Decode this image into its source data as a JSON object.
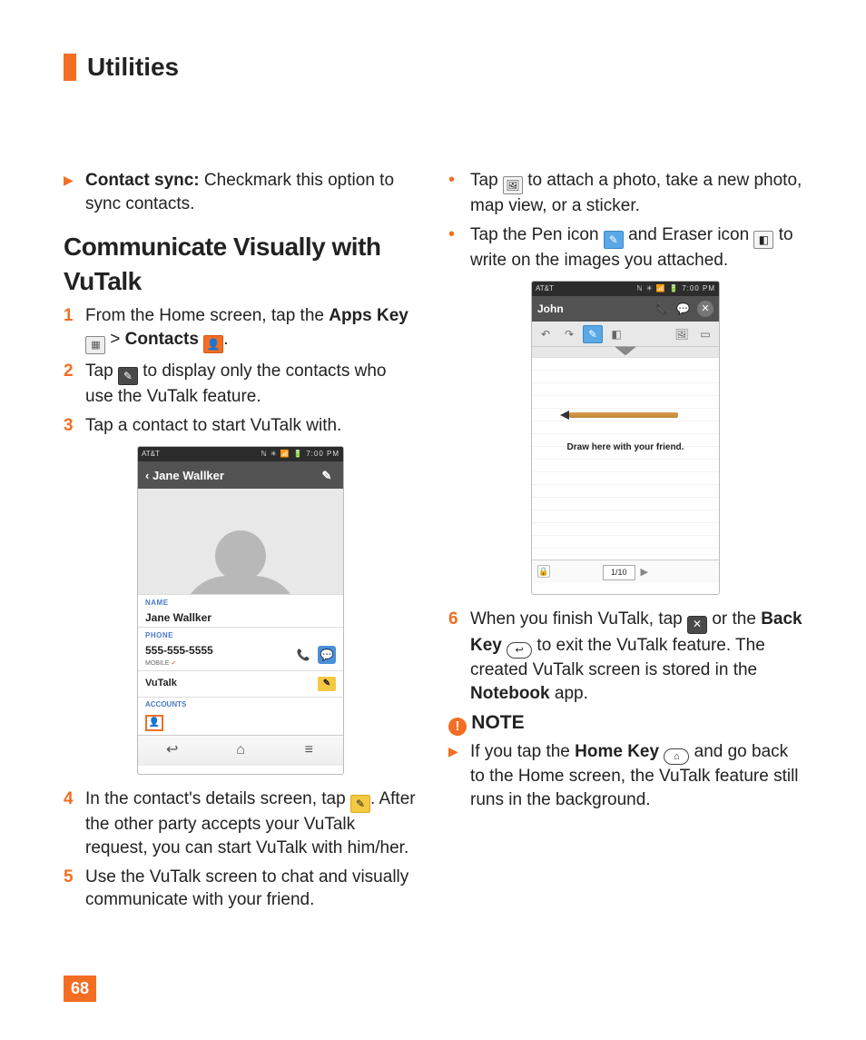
{
  "header": {
    "title": "Utilities"
  },
  "page_number": "68",
  "left": {
    "bullet1": {
      "lead": "Contact sync:",
      "rest": " Checkmark this option to sync contacts."
    },
    "section_heading": "Communicate Visually with VuTalk",
    "step1": {
      "n": "1",
      "a": "From the Home screen, tap the ",
      "b": "Apps Key",
      "c": " > ",
      "d": "Contacts",
      "e": "."
    },
    "step2": {
      "n": "2",
      "a": "Tap ",
      "b": " to display only the contacts who use the VuTalk feature."
    },
    "step3": {
      "n": "3",
      "a": "Tap a contact to start VuTalk with."
    },
    "step4": {
      "n": "4",
      "a": "In the contact's details screen, tap ",
      "b": ". After the other party accepts your VuTalk request, you can start VuTalk with him/her."
    },
    "step5": {
      "n": "5",
      "a": "Use the VuTalk screen to chat and visually communicate with your friend."
    }
  },
  "right": {
    "b1": {
      "a": "Tap ",
      "b": " to attach a photo, take a new photo, map view, or a sticker."
    },
    "b2": {
      "a": "Tap the Pen icon ",
      "b": " and Eraser icon ",
      "c": " to write on the images you attached."
    },
    "step6": {
      "n": "6",
      "a": "When you finish VuTalk, tap ",
      "b": " or the ",
      "c": "Back Key",
      "d": " to exit the VuTalk feature. The created VuTalk screen is stored in the ",
      "e": "Notebook",
      "f": " app."
    },
    "note_label": "NOTE",
    "note_body": {
      "a": "If you tap the ",
      "b": "Home Key",
      "c": " and go back to the Home screen, the VuTalk feature still runs in the background."
    }
  },
  "shot1": {
    "carrier": "AT&T",
    "time": "7:00 PM",
    "title": "Jane Wallker",
    "name_lbl": "NAME",
    "name_val": "Jane Wallker",
    "phone_lbl": "PHONE",
    "phone_val": "555-555-5555",
    "mobile": "MOBILE",
    "vutalk": "VuTalk",
    "accounts": "ACCOUNTS"
  },
  "shot2": {
    "carrier": "AT&T",
    "time": "7:00 PM",
    "name": "John",
    "canvas_text": "Draw here with your friend.",
    "page": "1/10"
  }
}
